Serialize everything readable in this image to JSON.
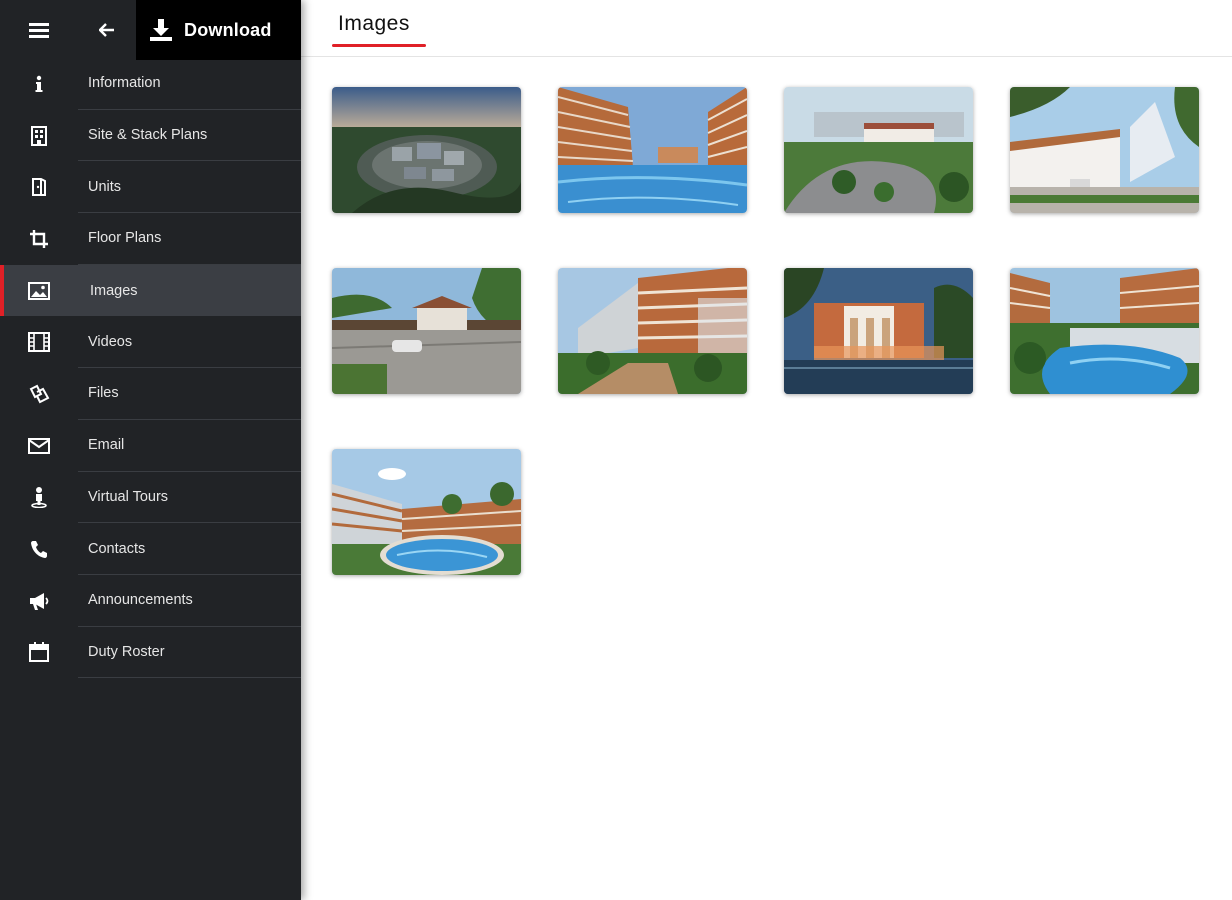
{
  "toolbar": {
    "menu_icon": "hamburger-menu-icon",
    "back_icon": "back-arrow-icon",
    "download_icon": "download-icon",
    "download_label": "Download"
  },
  "sidebar": {
    "items": [
      {
        "label": "Information",
        "icon": "info-icon",
        "active": false
      },
      {
        "label": "Site & Stack Plans",
        "icon": "building-icon",
        "active": false
      },
      {
        "label": "Units",
        "icon": "door-icon",
        "active": false
      },
      {
        "label": "Floor Plans",
        "icon": "crop-icon",
        "active": false
      },
      {
        "label": "Images",
        "icon": "image-icon",
        "active": true
      },
      {
        "label": "Videos",
        "icon": "film-icon",
        "active": false
      },
      {
        "label": "Files",
        "icon": "files-icon",
        "active": false
      },
      {
        "label": "Email",
        "icon": "envelope-icon",
        "active": false
      },
      {
        "label": "Virtual Tours",
        "icon": "person-pin-icon",
        "active": false
      },
      {
        "label": "Contacts",
        "icon": "phone-icon",
        "active": false
      },
      {
        "label": "Announcements",
        "icon": "megaphone-icon",
        "active": false
      },
      {
        "label": "Duty Roster",
        "icon": "calendar-icon",
        "active": false
      }
    ]
  },
  "main": {
    "title": "Images",
    "accent_color": "#e02027",
    "gallery": [
      {
        "scene": "aerial-estate-dusk"
      },
      {
        "scene": "pool-between-blocks"
      },
      {
        "scene": "drop-off-driveway"
      },
      {
        "scene": "clubhouse-entrance"
      },
      {
        "scene": "covered-drop-off"
      },
      {
        "scene": "landscaped-walkway"
      },
      {
        "scene": "clubhouse-night"
      },
      {
        "scene": "lagoon-pool"
      },
      {
        "scene": "round-pool"
      }
    ]
  }
}
